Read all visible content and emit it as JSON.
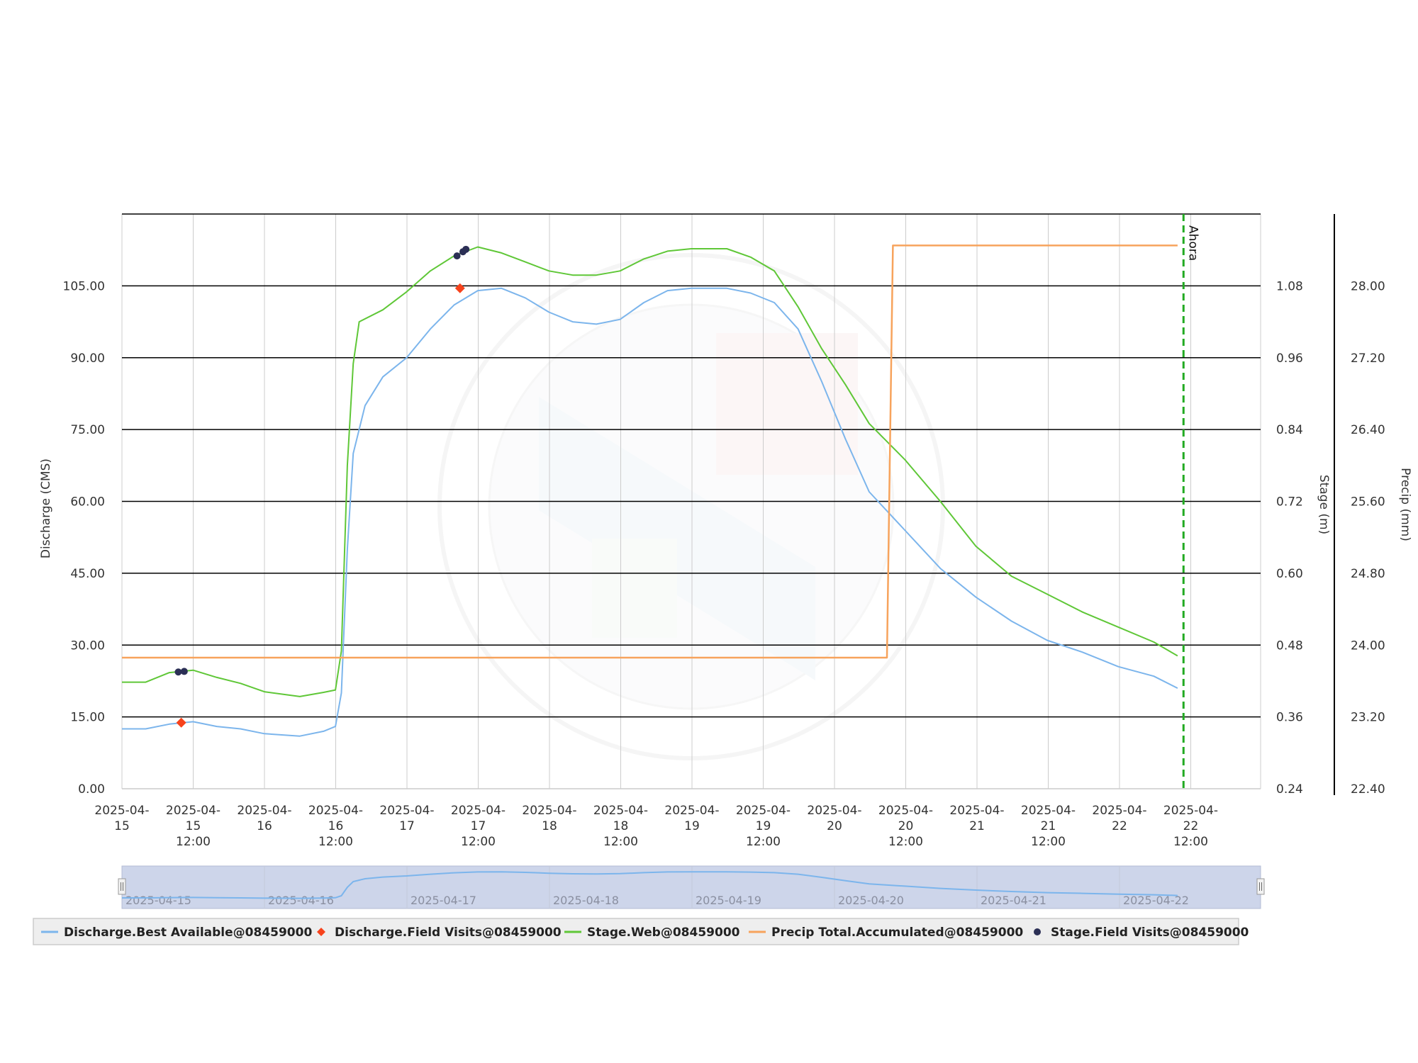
{
  "chart_data": {
    "type": "line",
    "title": "",
    "x_axis": {
      "start": "2025-04-15 00:00",
      "end": "2025-04-23 00:00",
      "tick_labels": [
        [
          "2025-04-",
          "15",
          ""
        ],
        [
          "2025-04-",
          "15",
          "12:00"
        ],
        [
          "2025-04-",
          "16",
          ""
        ],
        [
          "2025-04-",
          "16",
          "12:00"
        ],
        [
          "2025-04-",
          "17",
          ""
        ],
        [
          "2025-04-",
          "17",
          "12:00"
        ],
        [
          "2025-04-",
          "18",
          ""
        ],
        [
          "2025-04-",
          "18",
          "12:00"
        ],
        [
          "2025-04-",
          "19",
          ""
        ],
        [
          "2025-04-",
          "19",
          "12:00"
        ],
        [
          "2025-04-",
          "20",
          ""
        ],
        [
          "2025-04-",
          "20",
          "12:00"
        ],
        [
          "2025-04-",
          "21",
          ""
        ],
        [
          "2025-04-",
          "21",
          "12:00"
        ],
        [
          "2025-04-",
          "22",
          ""
        ],
        [
          "2025-04-",
          "22",
          "12:00"
        ]
      ],
      "grid": true
    },
    "y_axes": {
      "discharge": {
        "label": "Discharge (CMS)",
        "range": [
          0,
          120
        ],
        "ticks": [
          "0.00",
          "15.00",
          "30.00",
          "45.00",
          "60.00",
          "75.00",
          "90.00",
          "105.00"
        ]
      },
      "stage": {
        "label": "Stage (m)",
        "range": [
          0.24,
          1.2
        ],
        "ticks": [
          "0.24",
          "0.36",
          "0.48",
          "0.60",
          "0.72",
          "0.84",
          "0.96",
          "1.08"
        ]
      },
      "precip": {
        "label": "Precip (mm)",
        "range": [
          22.4,
          28.8
        ],
        "ticks": [
          "22.40",
          "23.20",
          "24.00",
          "24.80",
          "25.60",
          "26.40",
          "27.20",
          "28.00"
        ]
      }
    },
    "now_marker": {
      "label": "Ahora",
      "x": "2025-04-22 11:00",
      "color": "#22aa22"
    },
    "series": [
      {
        "name": "Discharge.Best Available@08459000",
        "axis": "discharge",
        "color": "#7cb5ec",
        "marker": "line",
        "points": [
          [
            "2025-04-15 00:00",
            12.5
          ],
          [
            "2025-04-15 04:00",
            12.5
          ],
          [
            "2025-04-15 08:00",
            13.5
          ],
          [
            "2025-04-15 12:00",
            14.0
          ],
          [
            "2025-04-15 16:00",
            13.0
          ],
          [
            "2025-04-15 20:00",
            12.5
          ],
          [
            "2025-04-16 00:00",
            11.5
          ],
          [
            "2025-04-16 06:00",
            11.0
          ],
          [
            "2025-04-16 10:00",
            12.0
          ],
          [
            "2025-04-16 12:00",
            13.0
          ],
          [
            "2025-04-16 13:00",
            20.0
          ],
          [
            "2025-04-16 14:00",
            50.0
          ],
          [
            "2025-04-16 15:00",
            70.0
          ],
          [
            "2025-04-16 17:00",
            80.0
          ],
          [
            "2025-04-16 20:00",
            86.0
          ],
          [
            "2025-04-17 00:00",
            90.0
          ],
          [
            "2025-04-17 04:00",
            96.0
          ],
          [
            "2025-04-17 08:00",
            101.0
          ],
          [
            "2025-04-17 12:00",
            104.0
          ],
          [
            "2025-04-17 16:00",
            104.5
          ],
          [
            "2025-04-17 20:00",
            102.5
          ],
          [
            "2025-04-18 00:00",
            99.5
          ],
          [
            "2025-04-18 04:00",
            97.5
          ],
          [
            "2025-04-18 08:00",
            97.0
          ],
          [
            "2025-04-18 12:00",
            98.0
          ],
          [
            "2025-04-18 16:00",
            101.5
          ],
          [
            "2025-04-18 20:00",
            104.0
          ],
          [
            "2025-04-19 00:00",
            104.5
          ],
          [
            "2025-04-19 06:00",
            104.5
          ],
          [
            "2025-04-19 10:00",
            103.5
          ],
          [
            "2025-04-19 14:00",
            101.5
          ],
          [
            "2025-04-19 18:00",
            96.0
          ],
          [
            "2025-04-19 22:00",
            85.0
          ],
          [
            "2025-04-20 02:00",
            73.0
          ],
          [
            "2025-04-20 06:00",
            62.0
          ],
          [
            "2025-04-20 12:00",
            54.0
          ],
          [
            "2025-04-20 18:00",
            46.0
          ],
          [
            "2025-04-21 00:00",
            40.0
          ],
          [
            "2025-04-21 06:00",
            35.0
          ],
          [
            "2025-04-21 12:00",
            31.0
          ],
          [
            "2025-04-21 18:00",
            28.5
          ],
          [
            "2025-04-22 00:00",
            25.5
          ],
          [
            "2025-04-22 06:00",
            23.5
          ],
          [
            "2025-04-22 10:00",
            21.0
          ]
        ]
      },
      {
        "name": "Discharge.Field Visits@08459000",
        "axis": "discharge",
        "color": "#f7431c",
        "marker": "diamond",
        "points": [
          [
            "2025-04-15 10:00",
            13.8
          ],
          [
            "2025-04-17 09:00",
            104.5
          ]
        ]
      },
      {
        "name": "Stage.Web@08459000",
        "axis": "stage",
        "color": "#5fc737",
        "marker": "line",
        "points": [
          [
            "2025-04-15 00:00",
            0.418
          ],
          [
            "2025-04-15 04:00",
            0.418
          ],
          [
            "2025-04-15 08:00",
            0.434
          ],
          [
            "2025-04-15 12:00",
            0.438
          ],
          [
            "2025-04-15 16:00",
            0.426
          ],
          [
            "2025-04-15 20:00",
            0.416
          ],
          [
            "2025-04-16 00:00",
            0.402
          ],
          [
            "2025-04-16 06:00",
            0.394
          ],
          [
            "2025-04-16 10:00",
            0.401
          ],
          [
            "2025-04-16 12:00",
            0.405
          ],
          [
            "2025-04-16 13:00",
            0.47
          ],
          [
            "2025-04-16 14:00",
            0.78
          ],
          [
            "2025-04-16 15:00",
            0.95
          ],
          [
            "2025-04-16 16:00",
            1.02
          ],
          [
            "2025-04-16 20:00",
            1.04
          ],
          [
            "2025-04-17 00:00",
            1.07
          ],
          [
            "2025-04-17 04:00",
            1.105
          ],
          [
            "2025-04-17 08:00",
            1.13
          ],
          [
            "2025-04-17 12:00",
            1.145
          ],
          [
            "2025-04-17 16:00",
            1.135
          ],
          [
            "2025-04-17 20:00",
            1.12
          ],
          [
            "2025-04-18 00:00",
            1.105
          ],
          [
            "2025-04-18 04:00",
            1.098
          ],
          [
            "2025-04-18 08:00",
            1.098
          ],
          [
            "2025-04-18 12:00",
            1.105
          ],
          [
            "2025-04-18 16:00",
            1.125
          ],
          [
            "2025-04-18 20:00",
            1.138
          ],
          [
            "2025-04-19 00:00",
            1.142
          ],
          [
            "2025-04-19 06:00",
            1.142
          ],
          [
            "2025-04-19 10:00",
            1.128
          ],
          [
            "2025-04-19 14:00",
            1.105
          ],
          [
            "2025-04-19 18:00",
            1.045
          ],
          [
            "2025-04-19 22:00",
            0.975
          ],
          [
            "2025-04-20 02:00",
            0.915
          ],
          [
            "2025-04-20 06:00",
            0.85
          ],
          [
            "2025-04-20 12:00",
            0.79
          ],
          [
            "2025-04-20 18:00",
            0.72
          ],
          [
            "2025-04-21 00:00",
            0.645
          ],
          [
            "2025-04-21 06:00",
            0.595
          ],
          [
            "2025-04-21 12:00",
            0.565
          ],
          [
            "2025-04-21 18:00",
            0.535
          ],
          [
            "2025-04-22 00:00",
            0.51
          ],
          [
            "2025-04-22 06:00",
            0.485
          ],
          [
            "2025-04-22 10:00",
            0.462
          ]
        ]
      },
      {
        "name": "Precip Total.Accumulated@08459000",
        "axis": "precip",
        "color": "#f7a35c",
        "marker": "step",
        "points": [
          [
            "2025-04-15 00:00",
            23.86
          ],
          [
            "2025-04-20 09:00",
            23.86
          ],
          [
            "2025-04-20 10:00",
            28.45
          ],
          [
            "2025-04-22 10:00",
            28.45
          ]
        ]
      },
      {
        "name": "Stage.Field Visits@08459000",
        "axis": "stage",
        "color": "#2b2f55",
        "marker": "circle",
        "points": [
          [
            "2025-04-15 09:30",
            0.435
          ],
          [
            "2025-04-15 10:30",
            0.436
          ],
          [
            "2025-04-17 08:30",
            1.13
          ],
          [
            "2025-04-17 09:30",
            1.137
          ],
          [
            "2025-04-17 10:00",
            1.141
          ]
        ]
      }
    ],
    "navigator": {
      "tick_labels": [
        "2025-04-15",
        "2025-04-16",
        "2025-04-17",
        "2025-04-18",
        "2025-04-19",
        "2025-04-20",
        "2025-04-21",
        "2025-04-22"
      ]
    },
    "legend_position": "bottom-left"
  }
}
